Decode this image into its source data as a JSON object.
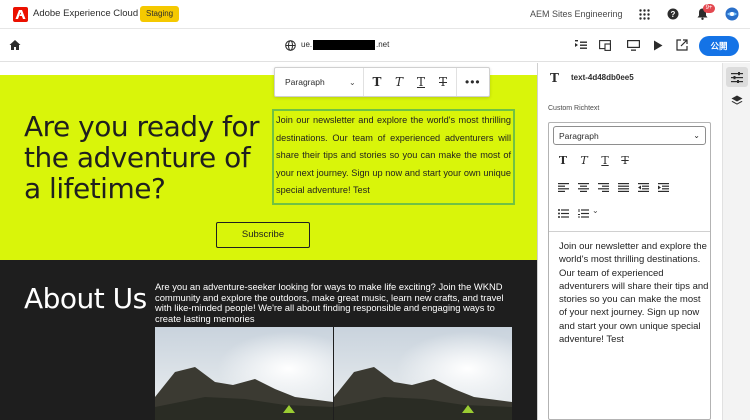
{
  "topbar": {
    "app_title": "Adobe Experience Cloud",
    "env_badge": "Staging",
    "org_name": "AEM Sites Engineering",
    "notification_count": "9+"
  },
  "toolbar": {
    "url_prefix": "ue.",
    "url_suffix": ".net",
    "publish_label": "公開"
  },
  "hero": {
    "title": "Are you ready for the adventure of a lifetime?",
    "body": "Join our newsletter and explore the world's most thrilling destinations. Our team of experienced adventurers will share their tips and stories so you can make the most of your next journey. Sign up now and start your own unique special adventure! Test",
    "subscribe_label": "Subscribe"
  },
  "inline_rte": {
    "paragraph_label": "Paragraph",
    "buttons": [
      "T",
      "T",
      "T",
      "T"
    ],
    "more": "•••"
  },
  "about": {
    "title": "About Us",
    "body": "Are you an adventure-seeker looking for ways to make life exciting? Join the WKND community and explore the outdoors, make great music, learn new crafts, and travel with like-minded people! We're all about finding responsible and engaging ways to create lasting memories"
  },
  "panel": {
    "component_id": "text-4d48db0ee5",
    "field_label": "Custom Richtext",
    "select_value": "Paragraph",
    "format_buttons": [
      "T",
      "T",
      "T",
      "T"
    ],
    "text": "Join our newsletter and explore the world's most thrilling destinations. Our team of experienced adventurers will share their tips and stories so you can make the most of your next journey. Sign up now and start your own unique special adventure! Test"
  },
  "colors": {
    "hero_bg": "#d9f50a",
    "dark_bg": "#1e1e1e",
    "publish_blue": "#1473e6",
    "env_yellow": "#f5c900",
    "adobe_red": "#eb1000",
    "selection_green": "#70c243"
  },
  "icons": [
    "adobe-logo-icon",
    "apps-grid-icon",
    "help-icon",
    "bell-icon",
    "avatar-icon",
    "home-icon",
    "globe-icon",
    "outline-icon",
    "responsive-icon",
    "desktop-icon",
    "play-icon",
    "open-external-icon",
    "properties-icon",
    "layers-icon"
  ]
}
